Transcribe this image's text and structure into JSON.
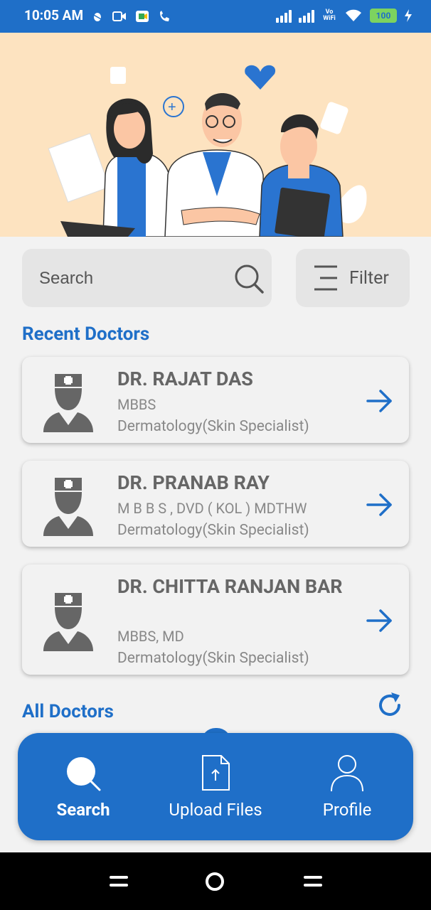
{
  "status_bar": {
    "time": "10:05 AM",
    "battery": "100",
    "network_label": "Vo WiFi"
  },
  "search": {
    "placeholder": "Search"
  },
  "filter": {
    "label": "Filter"
  },
  "sections": {
    "recent": "Recent Doctors",
    "all": "All Doctors"
  },
  "recent_doctors": [
    {
      "name": "DR. RAJAT DAS",
      "degree": "MBBS",
      "specialty": "Dermatology(Skin Specialist)"
    },
    {
      "name": "DR. PRANAB RAY",
      "degree": "M B B S , DVD ( KOL ) MDTHW",
      "specialty": "Dermatology(Skin Specialist)"
    },
    {
      "name": "DR. CHITTA RANJAN BAR",
      "degree": "MBBS, MD",
      "specialty": "Dermatology(Skin Specialist)"
    }
  ],
  "bottom_nav": {
    "search": "Search",
    "upload": "Upload Files",
    "profile": "Profile"
  },
  "colors": {
    "primary": "#1f6fc8",
    "background": "#f2f2f2",
    "hero": "#fde3c0",
    "card_text": "#666666"
  }
}
